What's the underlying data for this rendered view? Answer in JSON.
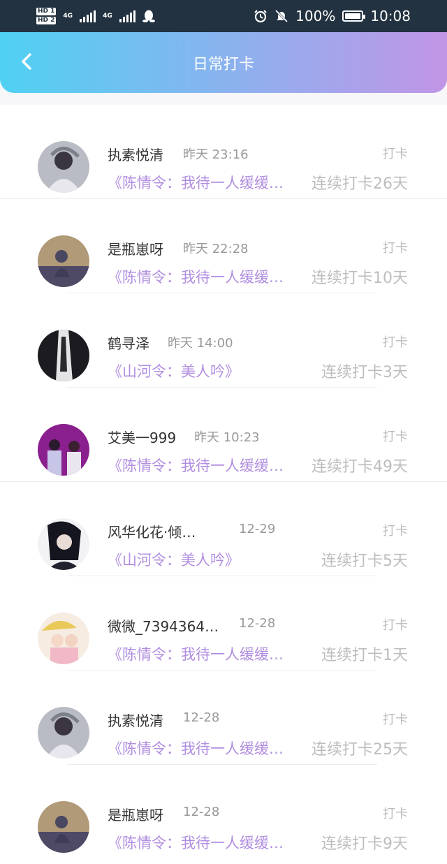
{
  "status_bar": {
    "hd1": "HD 1",
    "hd2": "HD 2",
    "net1": "4G",
    "net2": "4G",
    "battery": "100%",
    "time": "10:08"
  },
  "header": {
    "title": "日常打卡"
  },
  "entries": [
    {
      "name": "执素悦清",
      "time": "昨天 23:16",
      "action": "打卡",
      "book": "《陈情令：我待一人缓缓…",
      "streak": "连续打卡26天"
    },
    {
      "name": "是瓶崽呀",
      "time": "昨天 22:28",
      "action": "打卡",
      "book": "《陈情令：我待一人缓缓…",
      "streak": "连续打卡10天"
    },
    {
      "name": "鹤寻泽",
      "time": "昨天 14:00",
      "action": "打卡",
      "book": "《山河令：美人吟》",
      "streak": "连续打卡3天"
    },
    {
      "name": "艾美一999",
      "time": "昨天 10:23",
      "action": "打卡",
      "book": "《陈情令：我待一人缓缓…",
      "streak": "连续打卡49天"
    },
    {
      "name": "风华化花·倾…",
      "time": "12-29",
      "action": "打卡",
      "book": "《山河令：美人吟》",
      "streak": "连续打卡5天"
    },
    {
      "name": "微微_7394364…",
      "time": "12-28",
      "action": "打卡",
      "book": "《陈情令：我待一人缓缓归》",
      "streak": "连续打卡1天"
    },
    {
      "name": "执素悦清",
      "time": "12-28",
      "action": "打卡",
      "book": "《陈情令：我待一人缓缓…",
      "streak": "连续打卡25天"
    },
    {
      "name": "是瓶崽呀",
      "time": "12-28",
      "action": "打卡",
      "book": "《陈情令：我待一人缓缓归》",
      "streak": "连续打卡9天"
    }
  ],
  "colors": {
    "header_gradient_start": "#4fd1f2",
    "header_gradient_end": "#c195e6",
    "book_title": "#b18ee0",
    "muted": "#bdbdbd"
  }
}
